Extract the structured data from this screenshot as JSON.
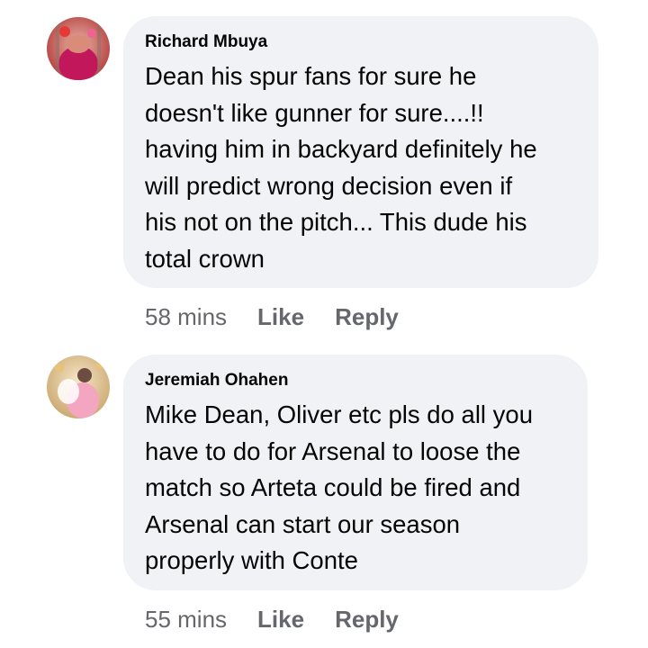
{
  "comments": [
    {
      "author": "Richard Mbuya",
      "lines": [
        "Dean his spur fans for sure he",
        "doesn't like gunner for sure....!!",
        "having him in backyard definitely he",
        "will predict wrong decision even if",
        "his not on the pitch... This dude his",
        "total crown"
      ],
      "time": "58 mins",
      "like_label": "Like",
      "reply_label": "Reply"
    },
    {
      "author": "Jeremiah Ohahen",
      "lines": [
        "Mike Dean, Oliver etc pls do all you",
        "have to do for Arsenal to loose the",
        "match so Arteta could be fired and",
        "Arsenal can start our season",
        "properly with Conte"
      ],
      "time": "55 mins",
      "like_label": "Like",
      "reply_label": "Reply"
    }
  ],
  "colors": {
    "bubble_bg": "#f0f2f5",
    "meta_text": "#65676b",
    "body_text": "#050505"
  },
  "icons": {
    "comment_1_avatar": "profile-photo-avatar",
    "comment_2_avatar": "profile-photo-avatar"
  }
}
